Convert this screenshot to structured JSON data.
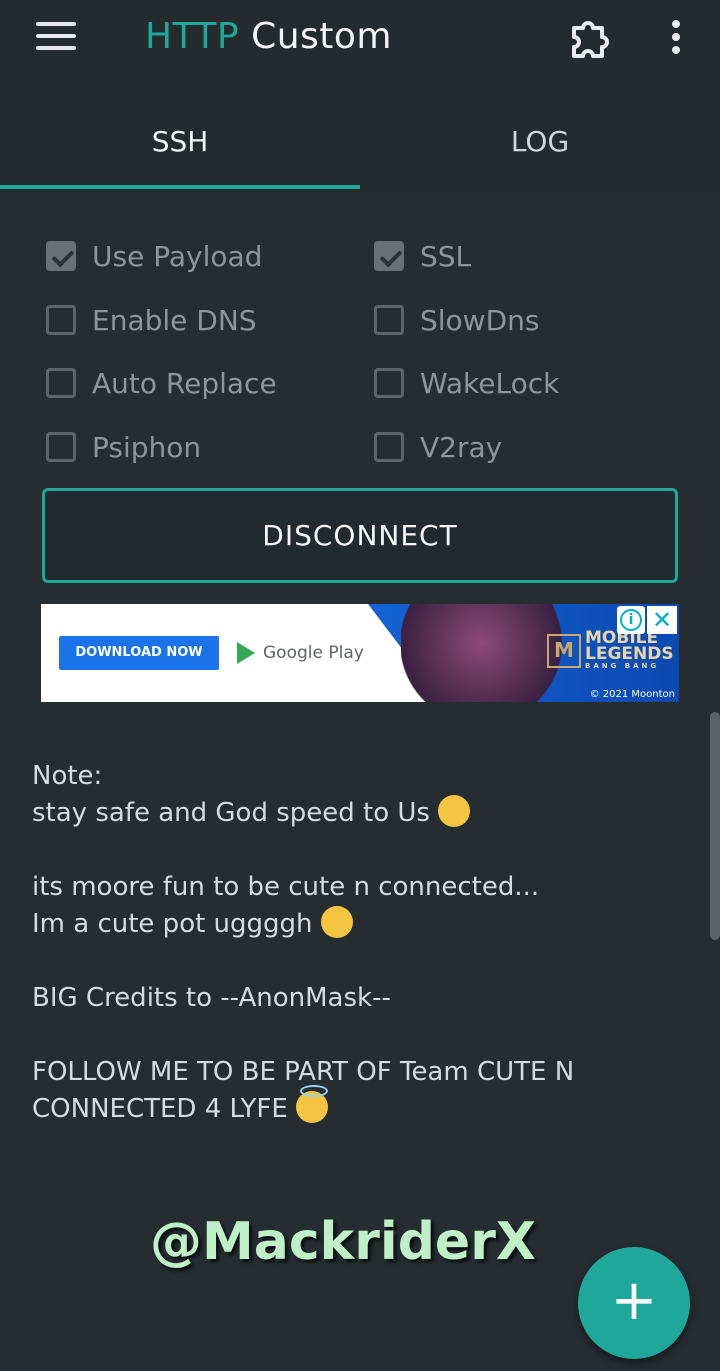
{
  "app": {
    "title_part1": "HTTP",
    "title_part2": " Custom"
  },
  "toolbar": {
    "menu_icon": "menu-icon",
    "plugin_icon": "puzzle-icon",
    "more_icon": "more-vert-icon"
  },
  "tabs": [
    {
      "label": "SSH",
      "active": true
    },
    {
      "label": "LOG",
      "active": false
    }
  ],
  "options": [
    {
      "label": "Use Payload",
      "checked": true
    },
    {
      "label": "SSL",
      "checked": true
    },
    {
      "label": "Enable DNS",
      "checked": false
    },
    {
      "label": "SlowDns",
      "checked": false
    },
    {
      "label": "Auto Replace",
      "checked": false
    },
    {
      "label": "WakeLock",
      "checked": false
    },
    {
      "label": "Psiphon",
      "checked": false
    },
    {
      "label": "V2ray",
      "checked": false
    }
  ],
  "connect_button": {
    "label": "DISCONNECT"
  },
  "ad": {
    "cta": "DOWNLOAD NOW",
    "store": "Google Play",
    "brand_line1": "MOBILE",
    "brand_line2": "LEGENDS",
    "brand_line3": "BANG BANG",
    "copyright": "© 2021 Moonton"
  },
  "note": {
    "line1": "Note:",
    "line2": "stay safe and God speed to Us",
    "line3": "its moore fun to be cute n connected...",
    "line4": "Im a cute pot uggggh",
    "line5": "BIG Credits to --AnonMask--",
    "line6": "FOLLOW ME TO BE PART OF Team CUTE N",
    "line7": "CONNECTED 4 LYFE"
  },
  "watermark": "@MackriderX",
  "fab": {
    "label": "+"
  },
  "colors": {
    "accent": "#1fa89a",
    "background": "#252d31"
  }
}
